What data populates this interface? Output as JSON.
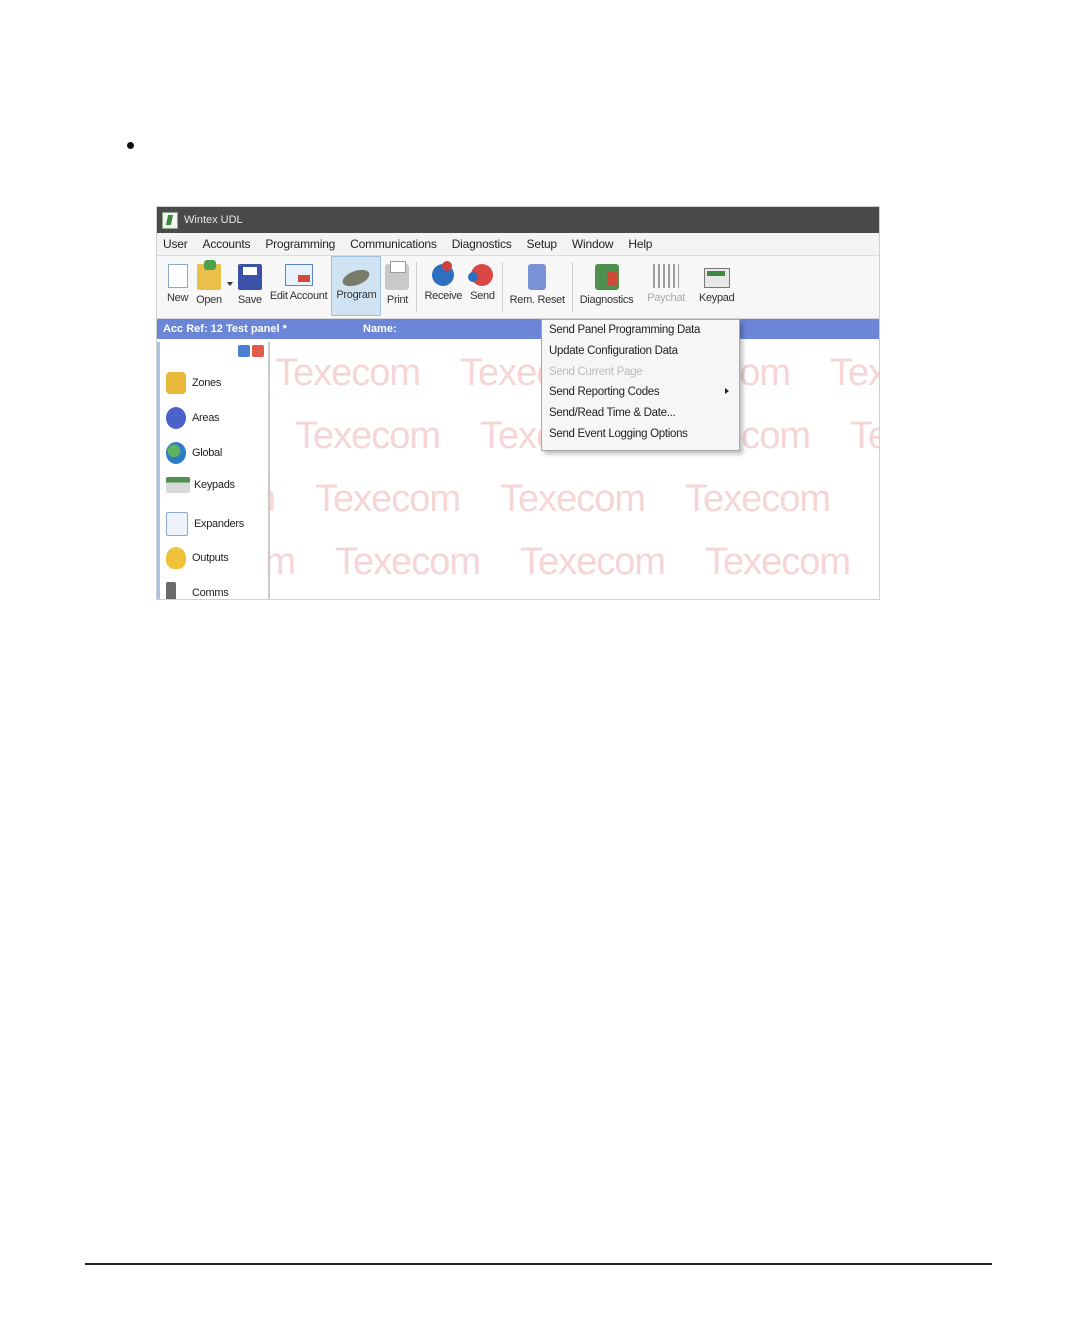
{
  "window": {
    "title": "Wintex UDL"
  },
  "menu": [
    "User",
    "Accounts",
    "Programming",
    "Communications",
    "Diagnostics",
    "Setup",
    "Window",
    "Help"
  ],
  "toolbar": {
    "new": "New",
    "open": "Open",
    "save": "Save",
    "edit_account": "Edit Account",
    "program": "Program",
    "print": "Print",
    "receive": "Receive",
    "send": "Send",
    "rem_reset": "Rem. Reset",
    "diagnostics": "Diagnostics",
    "paychat": "Paychat",
    "keypad": "Keypad"
  },
  "account_bar": {
    "account": "Acc Ref: 12 Test panel *",
    "name_label": "Name:"
  },
  "sidebar": {
    "items": [
      {
        "label": "Zones",
        "icon": "padlock-icon",
        "color": "#e7b83a"
      },
      {
        "label": "Areas",
        "icon": "areas-icon",
        "color": "#4a62c9"
      },
      {
        "label": "Global",
        "icon": "globe-icon",
        "color": "#2d7cc6"
      },
      {
        "label": "Keypads",
        "icon": "keypad-icon",
        "color": "#4f8f4f"
      },
      {
        "label": "Expanders",
        "icon": "expander-icon",
        "color": "#8fa6d6"
      },
      {
        "label": "Outputs",
        "icon": "bulb-icon",
        "color": "#f0c23a"
      },
      {
        "label": "Comms",
        "icon": "comms-icon",
        "color": "#6a6a6a"
      }
    ]
  },
  "watermark": "Texecom",
  "send_menu": {
    "items": [
      {
        "label": "Send Panel Programming Data",
        "enabled": true
      },
      {
        "label": "Update Configuration Data",
        "enabled": true
      },
      {
        "label": "Send Current Page",
        "enabled": false
      },
      {
        "label": "Send Reporting Codes",
        "enabled": true,
        "submenu": true
      },
      {
        "label": "Send/Read Time & Date...",
        "enabled": true
      },
      {
        "label": "Send Event Logging Options",
        "enabled": true
      }
    ]
  }
}
